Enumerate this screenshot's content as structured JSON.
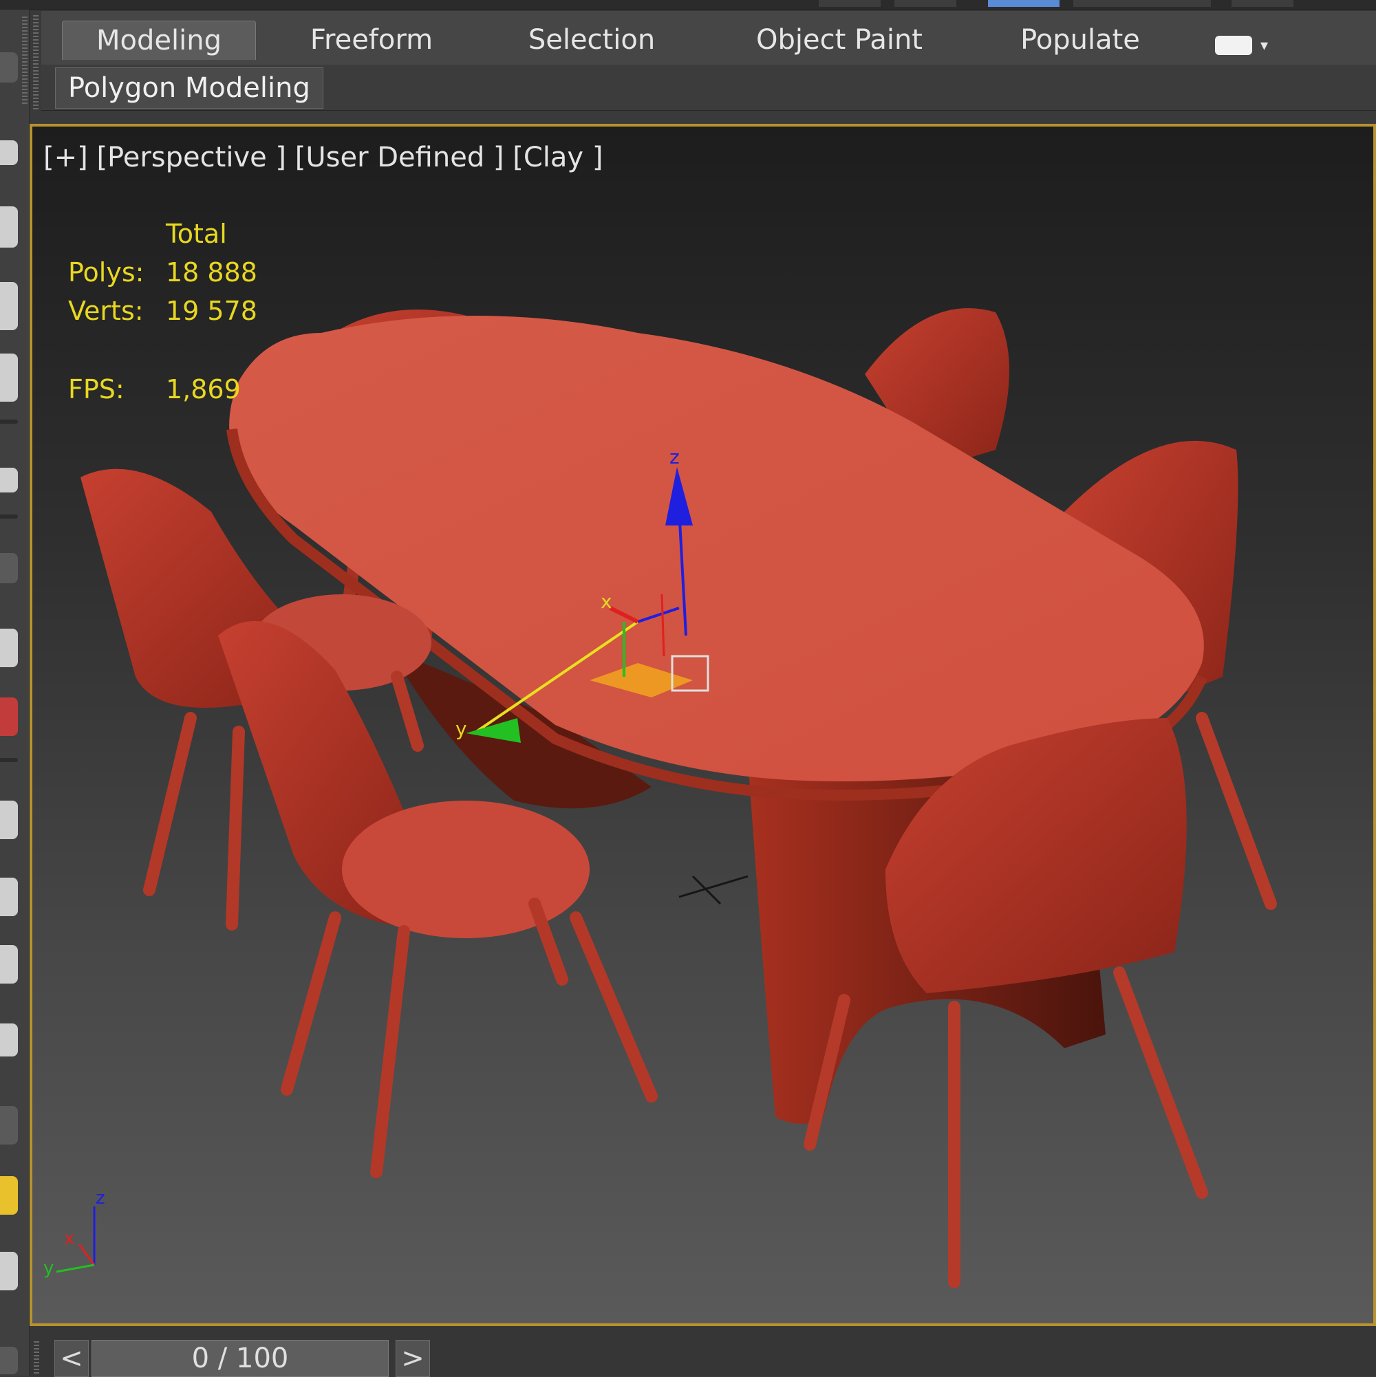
{
  "ribbon": {
    "tabs": [
      {
        "label": "Modeling",
        "active": true
      },
      {
        "label": "Freeform",
        "active": false
      },
      {
        "label": "Selection",
        "active": false
      },
      {
        "label": "Object Paint",
        "active": false
      },
      {
        "label": "Populate",
        "active": false
      }
    ],
    "subpanel_label": "Polygon Modeling"
  },
  "viewport": {
    "labels": [
      "[+]",
      "[Perspective ]",
      "[User Defined ]",
      "[Clay ]"
    ],
    "stats": {
      "header": "Total",
      "polys_label": "Polys:",
      "polys_value": "18 888",
      "verts_label": "Verts:",
      "verts_value": "19 578",
      "fps_label": "FPS:",
      "fps_value": "1,869"
    },
    "gizmo_axes": {
      "x": "x",
      "y": "y",
      "z": "z"
    },
    "corner_axes": {
      "x": "x",
      "y": "y",
      "z": "z"
    }
  },
  "timeline": {
    "prev": "<",
    "frame": "0 / 100",
    "next": ">"
  },
  "colors": {
    "viewport_border": "#b7922e",
    "stats_text": "#e8d820",
    "model_red": "#cd4a38",
    "axis_x": "#e02020",
    "axis_y": "#22c022",
    "axis_z": "#1f1fe0",
    "gizmo_plane": "#f0a020"
  }
}
